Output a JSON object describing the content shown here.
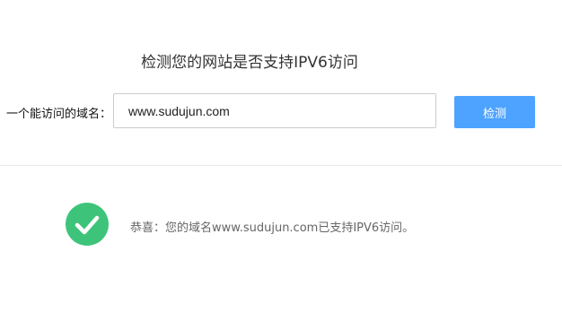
{
  "title": "检测您的网站是否支持IPV6访问",
  "form": {
    "label": "一个能访问的域名：",
    "domain_value": "www.sudujun.com",
    "button_label": "检测"
  },
  "result": {
    "icon": "check-circle-icon",
    "status": "success",
    "message": "恭喜：您的域名www.sudujun.com已支持IPV6访问。"
  },
  "colors": {
    "primary_button": "#4da3ff",
    "success_green": "#3ec47a",
    "text_muted": "#666666"
  }
}
